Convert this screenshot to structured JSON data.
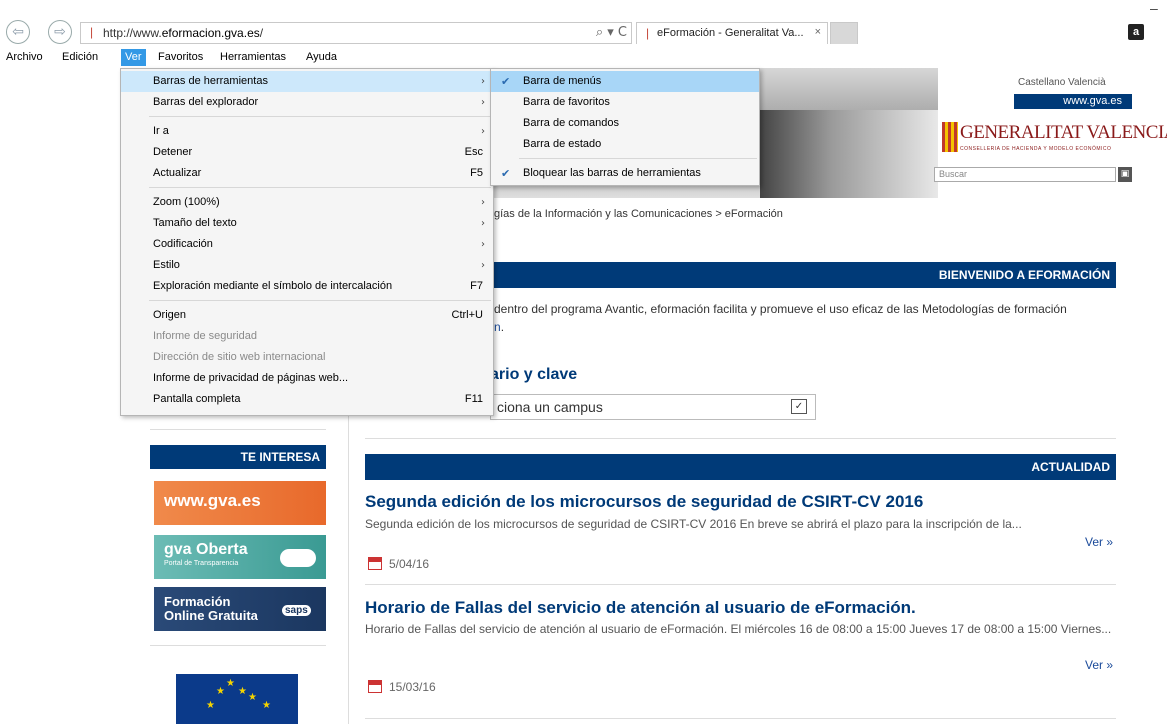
{
  "browser": {
    "url_prefix": "http://www.",
    "url_domain": "eformacion.gva.es",
    "url_suffix": "/",
    "address_tools": "⌕ ▾ C",
    "tab_title": "eFormación - Generalitat Va...",
    "tab_close": "×",
    "amazon": "a",
    "window_minus": "–",
    "back_icon": "⇦",
    "forward_icon": "⇨",
    "favicon": "❘"
  },
  "menubar": {
    "items": [
      "Archivo",
      "Edición",
      "Ver",
      "Favoritos",
      "Herramientas",
      "Ayuda"
    ]
  },
  "ver_menu": {
    "items": [
      {
        "label": "Barras de herramientas",
        "shortcut": "",
        "arrow": "›"
      },
      {
        "label": "Barras del explorador",
        "shortcut": "",
        "arrow": "›"
      },
      {
        "label": "Ir a",
        "shortcut": "",
        "arrow": "›"
      },
      {
        "label": "Detener",
        "shortcut": "Esc",
        "arrow": ""
      },
      {
        "label": "Actualizar",
        "shortcut": "F5",
        "arrow": ""
      },
      {
        "label": "Zoom (100%)",
        "shortcut": "",
        "arrow": "›"
      },
      {
        "label": "Tamaño del texto",
        "shortcut": "",
        "arrow": "›"
      },
      {
        "label": "Codificación",
        "shortcut": "",
        "arrow": "›"
      },
      {
        "label": "Estilo",
        "shortcut": "",
        "arrow": "›"
      },
      {
        "label": "Exploración mediante el símbolo de intercalación",
        "shortcut": "F7",
        "arrow": ""
      },
      {
        "label": "Origen",
        "shortcut": "Ctrl+U",
        "arrow": ""
      },
      {
        "label": "Informe de seguridad",
        "shortcut": "",
        "arrow": ""
      },
      {
        "label": "Dirección de sitio web internacional",
        "shortcut": "",
        "arrow": ""
      },
      {
        "label": "Informe de privacidad de páginas web...",
        "shortcut": "",
        "arrow": ""
      },
      {
        "label": "Pantalla completa",
        "shortcut": "F11",
        "arrow": ""
      }
    ]
  },
  "toolbars_submenu": {
    "check": "✔",
    "items": [
      {
        "label": "Barra de menús",
        "checked": true
      },
      {
        "label": "Barra de favoritos",
        "checked": false
      },
      {
        "label": "Barra de comandos",
        "checked": false
      },
      {
        "label": "Barra de estado",
        "checked": false
      },
      {
        "label": "Bloquear las barras de herramientas",
        "checked": true
      }
    ]
  },
  "header": {
    "lang_links": "Castellano  Valencià",
    "www": "www.gva.es",
    "logo_name": "GENERALITAT VALENCIANA",
    "logo_sub": "CONSELLERIA DE HACIENDA Y MODELO ECONÓMICO",
    "search_placeholder": "Buscar",
    "search_icon": "▣",
    "breadcrumb": "gías de la Información y las Comunicaciones > eFormación"
  },
  "welcome": {
    "bar": "BIENVENIDO A EFORMACIÓN",
    "intro_line1": "dentro del programa Avantic, eformación facilita y promueve el uso eficaz de las Metodologías de formación",
    "intro_link": "n",
    "intro_end": "."
  },
  "login": {
    "heading": "ario y clave",
    "campus_select": "ciona un campus",
    "select_arrow": "✓"
  },
  "news": {
    "bar": "ACTUALIDAD",
    "more": "Ver »",
    "items": [
      {
        "title": "Segunda edición de los microcursos de seguridad de CSIRT-CV 2016",
        "summary": "Segunda edición de los microcursos de seguridad de CSIRT-CV 2016    En breve se abrirá el plazo para la inscripción de la...",
        "date": "5/04/16"
      },
      {
        "title": "Horario de Fallas del servicio de atención al usuario de eFormación.",
        "summary": "Horario de Fallas del servicio de atención al usuario de eFormación. El miércoles 16 de 08:00 a 15:00  Jueves 17 de 08:00 a 15:00 Viernes...",
        "date": "15/03/16"
      }
    ]
  },
  "sidebar": {
    "bar": "TE INTERESA",
    "gva": "www.gva.es",
    "oberta_title": "gva Oberta",
    "oberta_sub": "Portal de Transparencia",
    "form_title": "Formación Online Gratuita",
    "saps": "saps",
    "star": "★"
  }
}
